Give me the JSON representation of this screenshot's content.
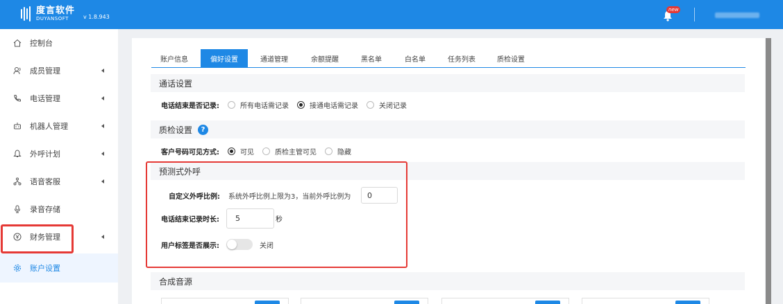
{
  "header": {
    "logo_cn": "度言软件",
    "logo_en": "DUYANSOFT",
    "version": "v 1.8.943",
    "new_badge": "new"
  },
  "sidebar": {
    "items": [
      {
        "label": "控制台",
        "icon": "home-icon",
        "has_arrow": false
      },
      {
        "label": "成员管理",
        "icon": "user-icon",
        "has_arrow": true
      },
      {
        "label": "电话管理",
        "icon": "phone-icon",
        "has_arrow": true
      },
      {
        "label": "机器人管理",
        "icon": "robot-icon",
        "has_arrow": true
      },
      {
        "label": "外呼计划",
        "icon": "bell-icon",
        "has_arrow": true
      },
      {
        "label": "语音客服",
        "icon": "network-icon",
        "has_arrow": true
      },
      {
        "label": "录音存储",
        "icon": "microphone-icon",
        "has_arrow": false
      },
      {
        "label": "财务管理",
        "icon": "yen-icon",
        "has_arrow": true
      },
      {
        "label": "账户设置",
        "icon": "gear-icon",
        "has_arrow": false,
        "active": true
      }
    ]
  },
  "tabs": [
    {
      "label": "账户信息"
    },
    {
      "label": "偏好设置",
      "active": true
    },
    {
      "label": "通道管理"
    },
    {
      "label": "余额提醒"
    },
    {
      "label": "黑名单"
    },
    {
      "label": "白名单"
    },
    {
      "label": "任务列表"
    },
    {
      "label": "质检设置"
    }
  ],
  "call_settings": {
    "title": "通话设置",
    "record_label": "电话结束是否记录:",
    "options": [
      "所有电话需记录",
      "接通电话需记录",
      "关闭记录"
    ],
    "selected": "接通电话需记录"
  },
  "qc_settings": {
    "title": "质检设置",
    "help": "?",
    "visibility_label": "客户号码可见方式:",
    "options": [
      "可见",
      "质检主管可见",
      "隐藏"
    ],
    "selected": "可见"
  },
  "predictive": {
    "title": "预测式外呼",
    "ratio_label": "自定义外呼比例:",
    "ratio_text": "系统外呼比例上限为3，当前外呼比例为",
    "ratio_value": "0",
    "duration_label": "电话结束记录时长:",
    "duration_value": "5",
    "duration_unit": "秒",
    "tag_label": "用户标签是否展示:",
    "tag_state": "关闭"
  },
  "tts": {
    "title": "合成音源"
  },
  "colors": {
    "primary": "#1e88e5",
    "highlight": "#e53935"
  }
}
